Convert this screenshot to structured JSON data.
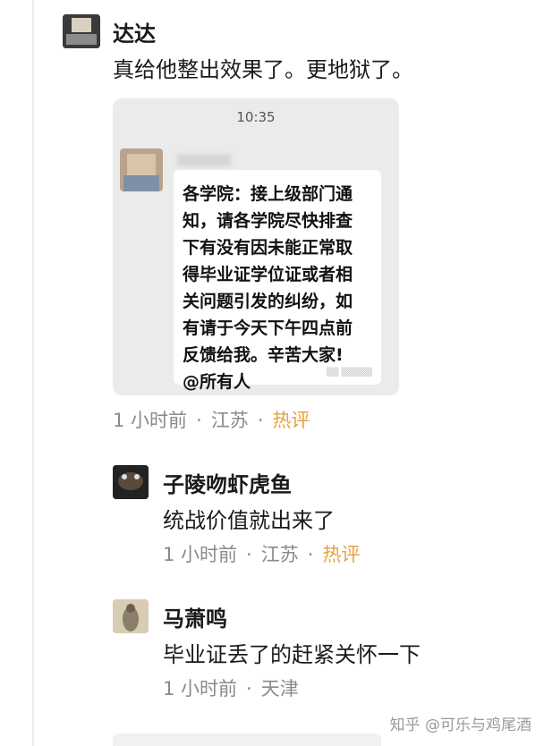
{
  "comments": [
    {
      "username": "达达",
      "text": "真给他整出效果了。更地狱了。",
      "time": "1 小时前",
      "location": "江苏",
      "badge": "热评",
      "attachment": {
        "time": "10:35",
        "message_lines": [
          "各学院：接上级部门通",
          "知，请各学院尽快排查",
          "下有没有因未能正常取",
          "得毕业证学位证或者相",
          "关问题引发的纠纷，如",
          "有请于今天下午四点前",
          "反馈给我。辛苦大家!",
          "@所有人"
        ]
      }
    },
    {
      "username": "子陵吻虾虎鱼",
      "text": "统战价值就出来了",
      "time": "1 小时前",
      "location": "江苏",
      "badge": "热评"
    },
    {
      "username": "马萧鸣",
      "text": "毕业证丢了的赶紧关怀一下",
      "time": "1 小时前",
      "location": "天津"
    }
  ],
  "separator": "·",
  "watermark": "知乎 @可乐与鸡尾酒"
}
